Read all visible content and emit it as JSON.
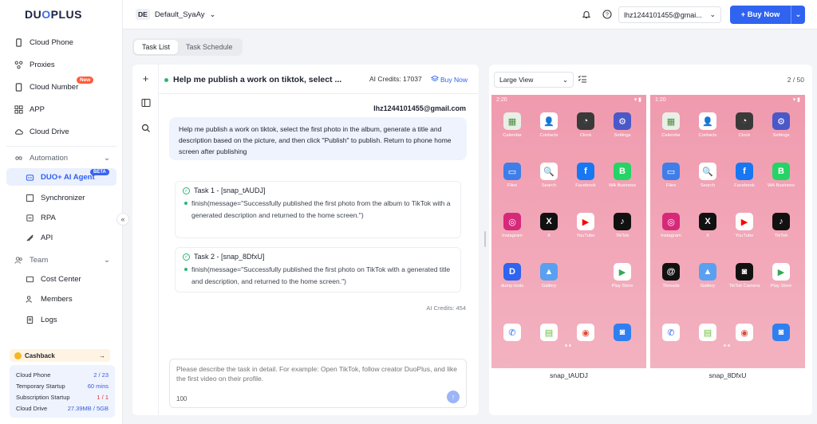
{
  "brand": {
    "logo_text_a": "DU",
    "logo_text_b": "O",
    "logo_text_c": "PLUS"
  },
  "sidebar": {
    "items": [
      {
        "label": "Cloud Phone",
        "icon": "phone-icon"
      },
      {
        "label": "Proxies",
        "icon": "proxy-icon"
      },
      {
        "label": "Cloud Number",
        "icon": "sim-icon",
        "badge": "New"
      },
      {
        "label": "APP",
        "icon": "grid-icon"
      },
      {
        "label": "Cloud Drive",
        "icon": "cloud-icon"
      }
    ],
    "automation": {
      "title": "Automation",
      "items": [
        {
          "label": "DUO+ AI Agent",
          "badge": "BETA"
        },
        {
          "label": "Synchronizer"
        },
        {
          "label": "RPA"
        },
        {
          "label": "API"
        }
      ]
    },
    "team": {
      "title": "Team",
      "items": [
        {
          "label": "Cost Center"
        },
        {
          "label": "Members"
        },
        {
          "label": "Logs"
        }
      ]
    },
    "collapse_glyph": "«",
    "cashback": {
      "label": "Cashback",
      "arrow": "→"
    },
    "usage": [
      {
        "label": "Cloud Phone",
        "value": "2 / 23"
      },
      {
        "label": "Temporary Startup",
        "value": "60 mins"
      },
      {
        "label": "Subscription Startup",
        "value": "1 / 1"
      },
      {
        "label": "Cloud Drive",
        "value": "27.39MB / 5GB"
      }
    ]
  },
  "header": {
    "env_badge": "DE",
    "env_name": "Default_SyaAy",
    "account": "lhz1244101455@gmai...",
    "buy_now": "+ Buy Now"
  },
  "tabs": [
    {
      "label": "Task List"
    },
    {
      "label": "Task Schedule"
    }
  ],
  "chat": {
    "title": "Help me publish a work on tiktok, select ...",
    "credits": "AI Credits: 17037",
    "buy_now": "Buy Now",
    "sender": "lhz1244101455@gmail.com",
    "message": "Help me publish a work on tiktok, select the first photo in the album, generate a title and description based on the picture, and then click \"Publish\" to publish. Return to phone home screen after publishing",
    "tasks": [
      {
        "title": "Task 1 - [snap_tAUDJ]",
        "result": "finish(message=\"Successfully published the first photo from the album to TikTok with a generated description and returned to the home screen.\")"
      },
      {
        "title": "Task 2 - [snap_8DfxU]",
        "result": "finish(message=\"Successfully published the first photo on TikTok with a generated title and description, and returned to the home screen.\")"
      }
    ],
    "ai_credits_used": "AI Credits: 454",
    "composer_placeholder": "Please describe the task in detail. For example: Open TikTok, follow creator DuoPlus, and like the first video on their profile.",
    "char_limit": "100"
  },
  "phones": {
    "view_mode": "Large View",
    "pager": "2 / 50",
    "devices": [
      {
        "name": "snap_tAUDJ",
        "time": "2:20",
        "apps": [
          {
            "label": "Calendar",
            "color": "#e8efe6",
            "glyph": "▦",
            "fg": "#4a8c3f"
          },
          {
            "label": "Contacts",
            "color": "#ffffff",
            "glyph": "👤",
            "fg": "#3a6fd8"
          },
          {
            "label": "Clock",
            "color": "#3a3a3a",
            "glyph": "◔",
            "fg": "#fff"
          },
          {
            "label": "Settings",
            "color": "#4b58c8",
            "glyph": "⚙",
            "fg": "#fff"
          },
          {
            "label": "Files",
            "color": "#3f7ee8",
            "glyph": "▭",
            "fg": "#fff"
          },
          {
            "label": "Search",
            "color": "#ffffff",
            "glyph": "🔍",
            "fg": "#333"
          },
          {
            "label": "Facebook",
            "color": "#1877f2",
            "glyph": "f",
            "fg": "#fff"
          },
          {
            "label": "WA Business",
            "color": "#25d366",
            "glyph": "B",
            "fg": "#fff"
          },
          {
            "label": "Instagram",
            "color": "#d6297a",
            "glyph": "◎",
            "fg": "#fff"
          },
          {
            "label": "X",
            "color": "#111111",
            "glyph": "X",
            "fg": "#fff"
          },
          {
            "label": "YouTube",
            "color": "#ffffff",
            "glyph": "▶",
            "fg": "#ff0000"
          },
          {
            "label": "TikTok",
            "color": "#111111",
            "glyph": "♪",
            "fg": "#fff"
          },
          {
            "label": "dump tools",
            "color": "#2f63f0",
            "glyph": "D",
            "fg": "#fff"
          },
          {
            "label": "Gallery",
            "color": "#5aa0f0",
            "glyph": "▲",
            "fg": "#fff"
          },
          {
            "label": "",
            "color": "transparent",
            "glyph": "",
            "fg": "#fff"
          },
          {
            "label": "Play Store",
            "color": "#ffffff",
            "glyph": "▶",
            "fg": "#34a853"
          },
          {
            "label": "",
            "color": "#ffffff",
            "glyph": "✆",
            "fg": "#2f63f0"
          },
          {
            "label": "",
            "color": "#ffffff",
            "glyph": "▤",
            "fg": "#6bbf3a"
          },
          {
            "label": "",
            "color": "#ffffff",
            "glyph": "◉",
            "fg": "#dd4b39"
          },
          {
            "label": "",
            "color": "#2f7ff0",
            "glyph": "◙",
            "fg": "#fff"
          }
        ]
      },
      {
        "name": "snap_8DfxU",
        "time": "1:20",
        "apps": [
          {
            "label": "Calendar",
            "color": "#e8efe6",
            "glyph": "▦",
            "fg": "#4a8c3f"
          },
          {
            "label": "Contacts",
            "color": "#ffffff",
            "glyph": "👤",
            "fg": "#3a6fd8"
          },
          {
            "label": "Clock",
            "color": "#3a3a3a",
            "glyph": "◔",
            "fg": "#fff"
          },
          {
            "label": "Settings",
            "color": "#4b58c8",
            "glyph": "⚙",
            "fg": "#fff"
          },
          {
            "label": "Files",
            "color": "#3f7ee8",
            "glyph": "▭",
            "fg": "#fff"
          },
          {
            "label": "Search",
            "color": "#ffffff",
            "glyph": "🔍",
            "fg": "#333"
          },
          {
            "label": "Facebook",
            "color": "#1877f2",
            "glyph": "f",
            "fg": "#fff"
          },
          {
            "label": "WA Business",
            "color": "#25d366",
            "glyph": "B",
            "fg": "#fff"
          },
          {
            "label": "Instagram",
            "color": "#d6297a",
            "glyph": "◎",
            "fg": "#fff"
          },
          {
            "label": "X",
            "color": "#111111",
            "glyph": "X",
            "fg": "#fff"
          },
          {
            "label": "YouTube",
            "color": "#ffffff",
            "glyph": "▶",
            "fg": "#ff0000"
          },
          {
            "label": "TikTok",
            "color": "#111111",
            "glyph": "♪",
            "fg": "#fff"
          },
          {
            "label": "Threads",
            "color": "#111111",
            "glyph": "@",
            "fg": "#fff"
          },
          {
            "label": "Gallery",
            "color": "#5aa0f0",
            "glyph": "▲",
            "fg": "#fff"
          },
          {
            "label": "TikTok Camera",
            "color": "#111111",
            "glyph": "◙",
            "fg": "#fff"
          },
          {
            "label": "Play Store",
            "color": "#ffffff",
            "glyph": "▶",
            "fg": "#34a853"
          },
          {
            "label": "",
            "color": "#ffffff",
            "glyph": "✆",
            "fg": "#2f63f0"
          },
          {
            "label": "",
            "color": "#ffffff",
            "glyph": "▤",
            "fg": "#6bbf3a"
          },
          {
            "label": "",
            "color": "#ffffff",
            "glyph": "◉",
            "fg": "#dd4b39"
          },
          {
            "label": "",
            "color": "#2f7ff0",
            "glyph": "◙",
            "fg": "#fff"
          }
        ]
      }
    ]
  },
  "colors": {
    "accent": "#2f63f0",
    "success": "#2bb673",
    "phone_bg": "#f09aae"
  }
}
